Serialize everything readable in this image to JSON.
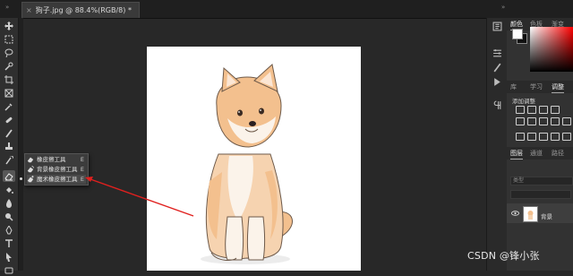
{
  "document": {
    "tab_title": "狗子.jpg @ 88.4%(RGB/8) *",
    "close_glyph": "×",
    "collapse_glyph": "»"
  },
  "flyout": {
    "items": [
      {
        "label": "橡皮擦工具",
        "shortcut": "E",
        "icon": "eraser-icon"
      },
      {
        "label": "背景橡皮擦工具",
        "shortcut": "E",
        "icon": "background-eraser-icon"
      },
      {
        "label": "魔术橡皮擦工具",
        "shortcut": "E",
        "icon": "magic-eraser-icon"
      }
    ],
    "selected_index": 2
  },
  "panels": {
    "color_tabs": [
      "颜色",
      "色板",
      "渐变"
    ],
    "learn_tabs": [
      "库",
      "学习",
      "调整"
    ],
    "adjust_label": "添加调整",
    "layer_tabs": [
      "图层",
      "通道",
      "路径"
    ],
    "layer_search_placeholder": "类型",
    "layer_name": "背景"
  },
  "watermark": "CSDN @锋小张",
  "colors": {
    "arrow": "#e0201e",
    "canvas": "#ffffff",
    "accent_fur": "#f3c08e"
  }
}
